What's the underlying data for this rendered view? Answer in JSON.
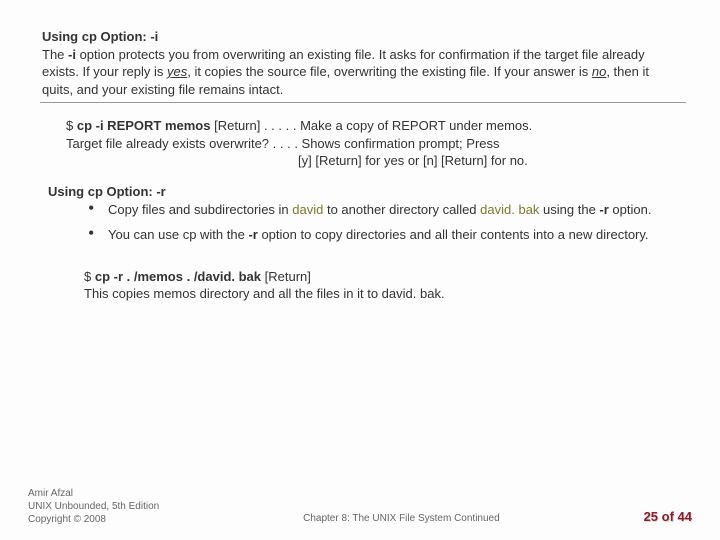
{
  "section_i": {
    "heading": "Using cp Option: -i",
    "p1a": "The ",
    "p1_opt": "-i",
    "p1b": " option protects you from overwriting an existing file. It asks for confirmation if the target file already exists. If your reply is ",
    "yes": "yes",
    "p1c": ", it copies the source file, overwriting the existing file. If your answer is ",
    "no": "no",
    "p1d": ", then it quits, and your existing file remains intact.",
    "ex_prefix": "$ ",
    "ex_cmd": "cp -i REPORT memos",
    "ex_ret": " [Return] . . . . . Make a copy of REPORT under memos.",
    "ex_l2": "Target file already exists overwrite? . . . . Shows confirmation prompt; Press",
    "ex_l3": "[y] [Return] for yes or [n] [Return] for no."
  },
  "section_r": {
    "heading": "Using cp Option: -r",
    "b1a": "Copy files and subdirectories in ",
    "b1_dir1": "david",
    "b1b": " to another directory called ",
    "b1_dir2": "david. bak",
    "b1c": " using the ",
    "b1_opt": "-r",
    "b1d": " option.",
    "b2a": "You can use cp with the ",
    "b2_opt": "-r",
    "b2b": " option to copy directories and all their contents into a new directory.",
    "ex_prefix": "$ ",
    "ex_cmd": "cp -r . /memos . /david. bak",
    "ex_ret": " [Return]",
    "ex_l2": "This copies memos directory and all the files in it to david. bak."
  },
  "footer": {
    "l1": "Amir Afzal",
    "l2": "UNIX Unbounded, 5th Edition",
    "l3": "Copyright © 2008",
    "center": "Chapter 8: The UNIX File System Continued",
    "page": "25 of 44"
  }
}
